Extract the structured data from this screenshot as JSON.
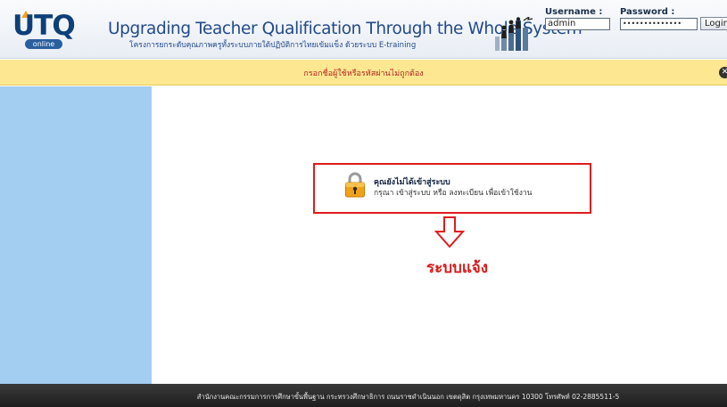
{
  "header": {
    "logo_text": "UTQ",
    "logo_badge": "online",
    "title": "Upgrading Teacher Qualification Through the Whole System",
    "subtitle": "โครงการยกระดับคุณภาพครูทั้งระบบภายใต้ปฏิบัติการไทยเข้มแข็ง ด้วยระบบ E-training"
  },
  "login": {
    "username_label": "Username :",
    "username_value": "admin",
    "password_label": "Password :",
    "password_value": "••••••••••••••",
    "login_button": "Login"
  },
  "alert": {
    "message": "กรอกชื่อผู้ใช้หรือรหัสผ่านไม่ถูกต้อง",
    "close_icon": "close-icon"
  },
  "notice": {
    "title": "คุณยังไม่ได้เข้าสู่ระบบ",
    "body": "กรุณา เข้าสู่ระบบ หรือ ลงทะเบียน เพื่อเข้าใช้งาน",
    "icon": "lock-icon"
  },
  "annotation": {
    "text": "ระบบแจ้ง",
    "icon": "arrow-down-icon"
  },
  "footer": {
    "text": "สำนักงานคณะกรรมการการศึกษาขั้นพื้นฐาน กระทรวงศึกษาธิการ ถนนราชดำเนินนอก เขตดุสิต กรุงเทพมหานคร 10300 โทรศัพท์ 02-2885511-5"
  },
  "colors": {
    "header_title": "#224a8b",
    "alert_bg": "#fde891",
    "alert_text": "#b32020",
    "sidebar": "#a4cdf2",
    "highlight_red": "#e01b1b",
    "footer_bg": "#2a2a2a"
  }
}
